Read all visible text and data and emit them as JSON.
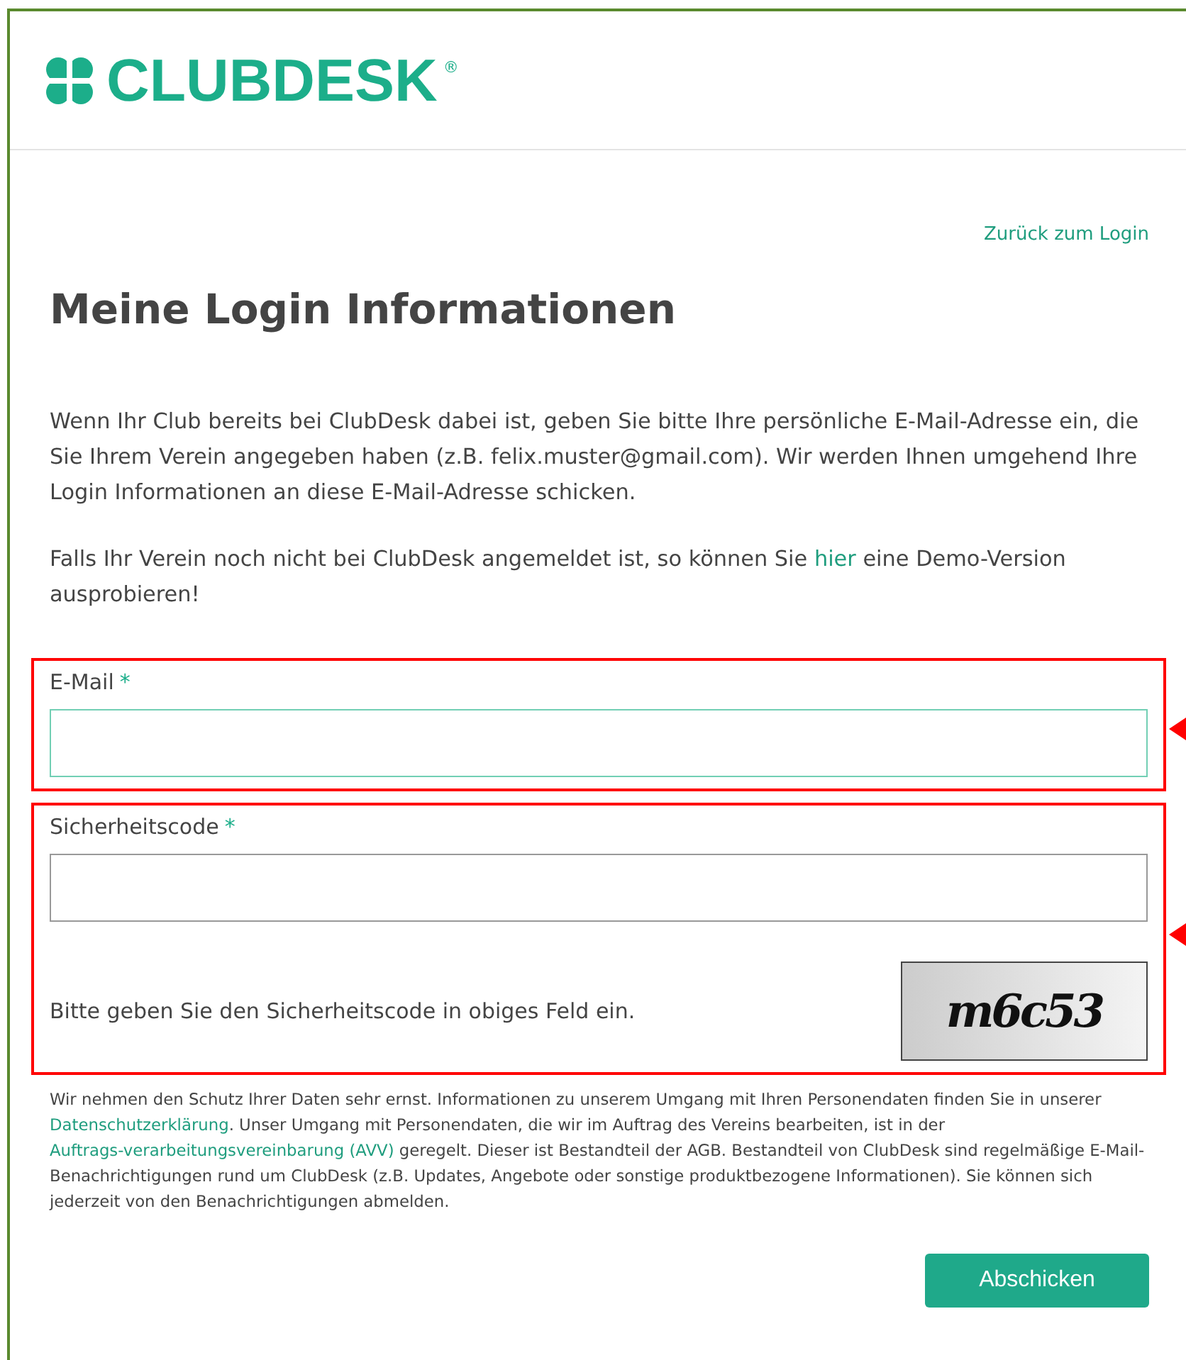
{
  "header": {
    "logo": "CLUBDESK",
    "registered": "®"
  },
  "back_link": "Zurück zum Login",
  "title": "Meine Login Informationen",
  "intro": "Wenn Ihr Club bereits bei ClubDesk dabei ist, geben Sie bitte Ihre persönliche E-Mail-Adresse ein, die Sie Ihrem Verein angegeben haben (z.B. felix.muster@gmail.com). Wir werden Ihnen umgehend Ihre Login Informationen an diese E-Mail-Adresse schicken.",
  "demo": {
    "before": "Falls Ihr Verein noch nicht bei ClubDesk angemeldet ist, so können Sie",
    "link": "hier",
    "after": "eine Demo-Version ausprobieren!"
  },
  "fields": [
    {
      "label": "E-Mail",
      "required": "*",
      "focused": true
    },
    {
      "label": "Sicherheitscode",
      "required": "*",
      "focused": false,
      "hint": "Bitte geben Sie den Sicherheitscode in obiges Feld ein.",
      "captcha": "m6c53"
    }
  ],
  "privacy": [
    {
      "kind": "text",
      "text": "Wir nehmen den Schutz Ihrer Daten sehr ernst. Informationen zu unserem Umgang mit Ihren Personendaten finden Sie in unserer"
    },
    {
      "kind": "link",
      "text": "Datenschutzerklärung"
    },
    {
      "kind": "text",
      "text": ". Unser Umgang mit Personendaten, die wir im Auftrag des Vereins bearbeiten, ist in der"
    },
    {
      "kind": "link",
      "text": "Auftrags-verarbeitungsvereinbarung (AVV)"
    },
    {
      "kind": "text",
      "text": "geregelt. Dieser ist Bestandteil der AGB. Bestandteil von ClubDesk sind regelmäßige E-Mail-Benachrichtigungen rund um ClubDesk (z.B. Updates, Angebote oder sonstige produktbezogene Informationen). Sie können sich jederzeit von den Benachrichtigungen abmelden."
    }
  ],
  "submit": "Abschicken"
}
